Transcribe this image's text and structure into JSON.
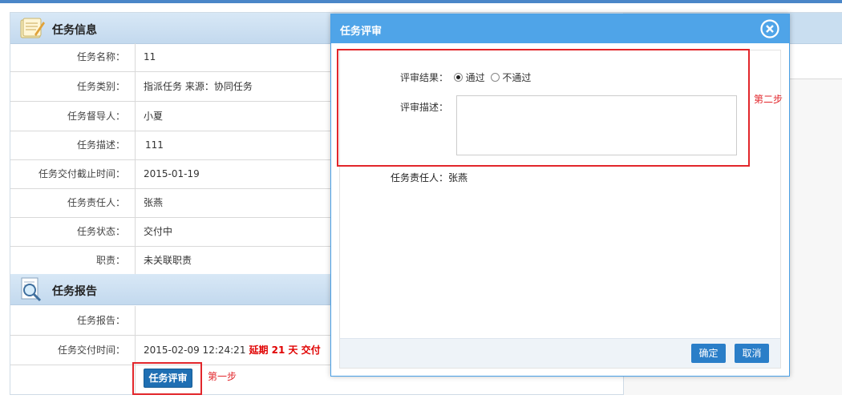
{
  "task_info": {
    "section_title": "任务信息",
    "rows": [
      {
        "label": "任务名称：",
        "value": "11"
      },
      {
        "label": "任务类别：",
        "value": "指派任务 来源：协同任务"
      },
      {
        "label": "任务督导人：",
        "value": "小夏"
      },
      {
        "label": "任务描述：",
        "value": "111"
      },
      {
        "label": "任务交付截止时间：",
        "value": "2015-01-19"
      },
      {
        "label": "任务责任人：",
        "value": "张燕"
      },
      {
        "label": "任务状态：",
        "value": "交付中"
      },
      {
        "label": "职责：",
        "value": "未关联职责"
      }
    ]
  },
  "task_report": {
    "section_title": "任务报告",
    "report_label": "任务报告：",
    "report_value": "",
    "delivery_label": "任务交付时间：",
    "delivery_value": "2015-02-09 12:24:21",
    "overdue_text": "延期 21 天 交付"
  },
  "review_button_label": "任务评审",
  "step1_note": "第一步",
  "step2_note": "第二步",
  "dialog": {
    "title": "任务评审",
    "result_label": "评审结果：",
    "option_pass": "通过",
    "option_fail": "不通过",
    "selected_option": "通过",
    "desc_label": "评审描述：",
    "desc_value": "",
    "owner_label": "任务责任人：",
    "owner_value": "张燕",
    "confirm_label": "确定",
    "cancel_label": "取消"
  },
  "colors": {
    "accent": "#4fa4e8",
    "header_bg": "#c9def0",
    "highlight_red": "#e2262b",
    "overdue_red": "#e00000",
    "button_blue": "#1f6fb3"
  }
}
